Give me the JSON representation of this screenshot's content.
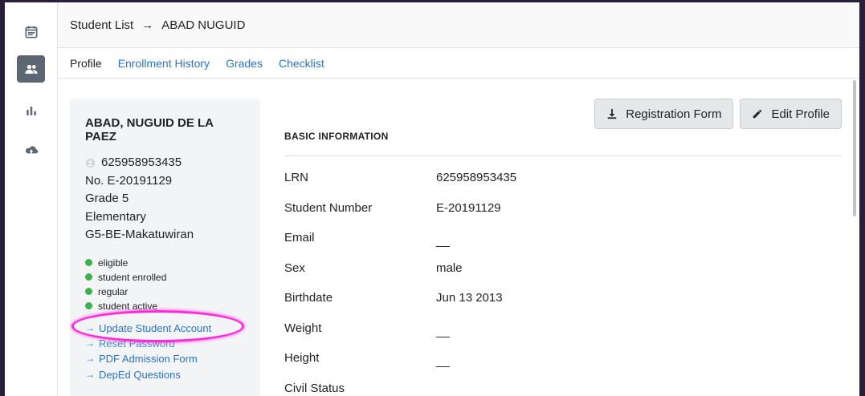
{
  "nav": {
    "items": [
      {
        "name": "calendar-icon",
        "active": false
      },
      {
        "name": "students-icon",
        "active": true
      },
      {
        "name": "reports-icon",
        "active": false
      },
      {
        "name": "upload-icon",
        "active": false
      }
    ]
  },
  "breadcrumb": {
    "root": "Student List",
    "separator": "→",
    "current": "ABAD NUGUID"
  },
  "tabs": [
    "Profile",
    "Enrollment History",
    "Grades",
    "Checklist"
  ],
  "card": {
    "name": "ABAD, NUGUID DE LA PAEZ",
    "lrn": "625958953435",
    "student_no": "No. E-20191129",
    "grade": "Grade 5",
    "level": "Elementary",
    "section": "G5-BE-Makatuwiran",
    "statuses": [
      "eligible",
      "student enrolled",
      "regular",
      "student active"
    ],
    "links": [
      "Update Student Account",
      "Reset Password",
      "PDF Admission Form",
      "DepEd Questions"
    ]
  },
  "actions": {
    "registration_form": "Registration Form",
    "edit_profile": "Edit Profile"
  },
  "basic_info": {
    "title": "BASIC INFORMATION",
    "rows": [
      {
        "label": "LRN",
        "value": "625958953435"
      },
      {
        "label": "Student Number",
        "value": "E-20191129"
      },
      {
        "label": "Email",
        "value": "__"
      },
      {
        "label": "Sex",
        "value": "male"
      },
      {
        "label": "Birthdate",
        "value": "Jun 13 2013"
      },
      {
        "label": "Weight",
        "value": "__"
      },
      {
        "label": "Height",
        "value": "__"
      },
      {
        "label": "Civil Status",
        "value": "__"
      }
    ]
  },
  "colors": {
    "link": "#2b74c7",
    "status_dot": "#3bb24f",
    "annotation": "#ff2bd9",
    "active_nav": "#5d6673"
  }
}
